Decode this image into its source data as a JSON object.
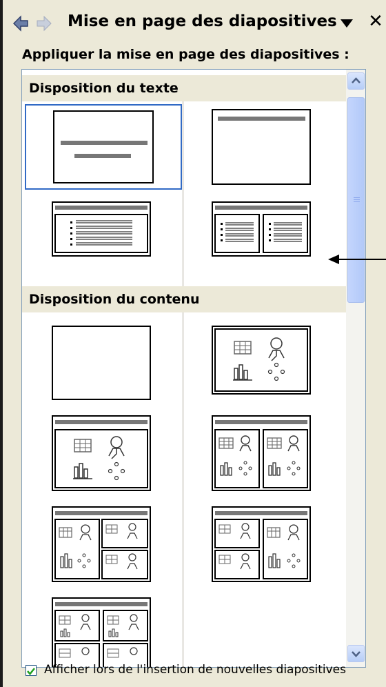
{
  "pane": {
    "title": "Mise en page des diapositives",
    "back_icon": "back-arrow-icon",
    "forward_icon": "forward-arrow-icon",
    "dropdown_icon": "triangle-down-icon",
    "close_glyph": "✕"
  },
  "apply_label": "Appliquer la mise en page des diapositives :",
  "sections": [
    {
      "title": "Disposition du texte"
    },
    {
      "title": "Disposition du contenu"
    }
  ],
  "layouts": {
    "text": [
      "title-slide",
      "title-only",
      "title-and-text",
      "title-and-2-column-text"
    ],
    "content": [
      "blank",
      "content",
      "title-and-content",
      "title-and-2-content",
      "title-and-4-content-a",
      "title-and-4-content-b",
      "title-and-4-content-c"
    ]
  },
  "footer": {
    "checkbox_label": "Afficher lors de l'insertion de nouvelles diapositives",
    "checked": true
  },
  "colors": {
    "selection": "#316ac5",
    "section_bg": "#ece9d8",
    "panel_bg": "#ece9d8"
  }
}
